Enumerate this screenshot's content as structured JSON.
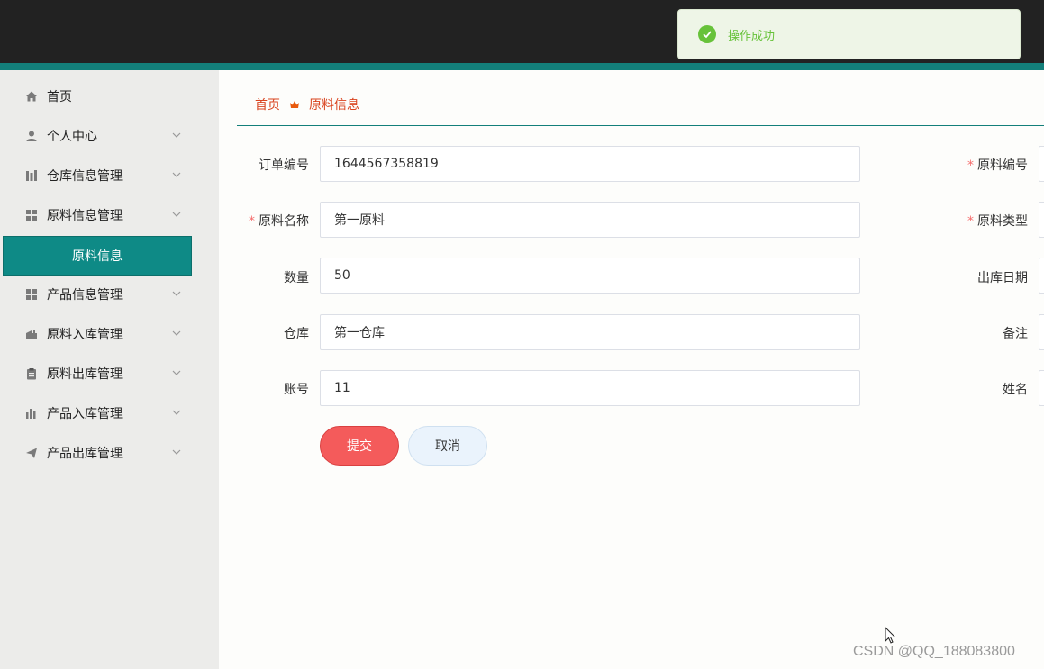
{
  "toast": {
    "message": "操作成功",
    "icon": "check-circle-icon",
    "color": "#67c23a"
  },
  "sidebar": {
    "items": [
      {
        "label": "首页",
        "icon": "home-icon"
      },
      {
        "label": "个人中心",
        "icon": "user-icon"
      },
      {
        "label": "仓库信息管理",
        "icon": "warehouse-icon"
      },
      {
        "label": "原料信息管理",
        "icon": "grid-icon"
      },
      {
        "label": "产品信息管理",
        "icon": "grid-icon"
      },
      {
        "label": "原料入库管理",
        "icon": "inbox-icon"
      },
      {
        "label": "原料出库管理",
        "icon": "clipboard-icon"
      },
      {
        "label": "产品入库管理",
        "icon": "bar-chart-icon"
      },
      {
        "label": "产品出库管理",
        "icon": "send-icon"
      }
    ],
    "active_sub": "原料信息"
  },
  "breadcrumb": {
    "home": "首页",
    "current": "原料信息"
  },
  "form": {
    "order_no": {
      "label": "订单编号",
      "value": "1644567358819"
    },
    "material_name": {
      "label": "原料名称",
      "value": "第一原料"
    },
    "quantity": {
      "label": "数量",
      "value": "50"
    },
    "warehouse": {
      "label": "仓库",
      "value": "第一仓库"
    },
    "account": {
      "label": "账号",
      "value": "11"
    },
    "material_code": {
      "label": "原料编号"
    },
    "material_type": {
      "label": "原料类型"
    },
    "out_date": {
      "label": "出库日期"
    },
    "remark": {
      "label": "备注"
    },
    "name": {
      "label": "姓名"
    },
    "submit_label": "提交",
    "cancel_label": "取消"
  },
  "watermark": "CSDN @QQ_188083800",
  "colors": {
    "accent": "#137f7a",
    "active_menu": "#0e8a86",
    "submit": "#f45b5b",
    "breadcrumb": "#d9431e"
  }
}
